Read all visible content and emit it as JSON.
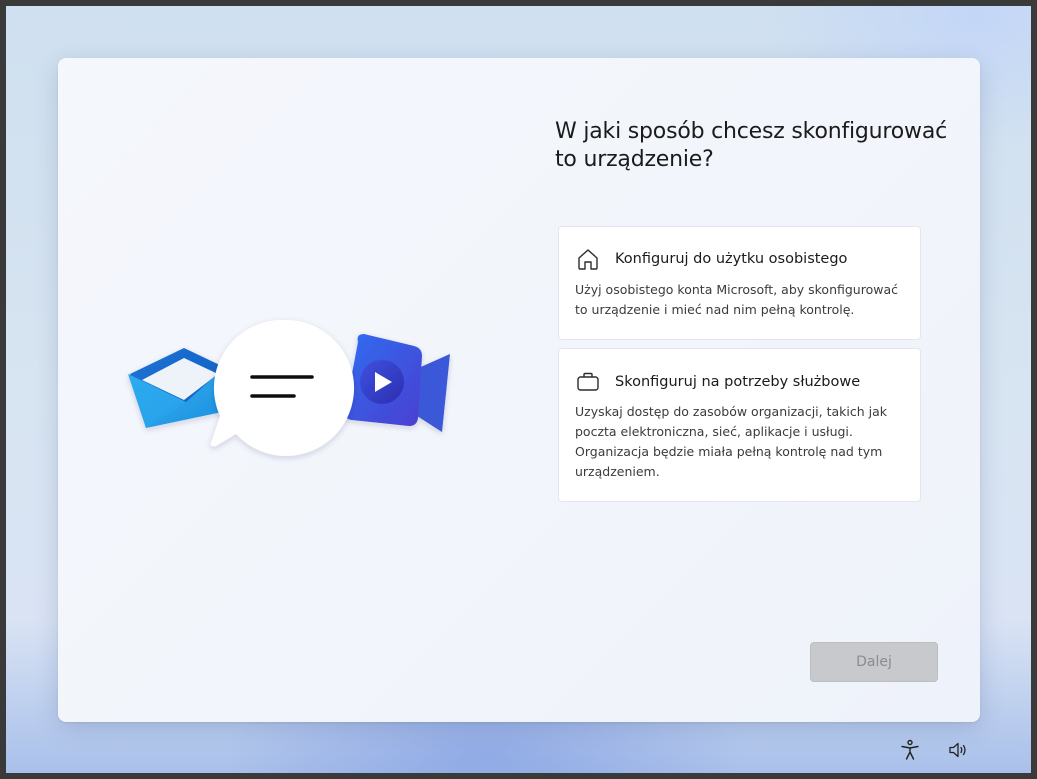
{
  "page": {
    "title": "W jaki sposób chcesz skonfigurować to urządzenie?"
  },
  "options": [
    {
      "title": "Konfiguruj do użytku osobistego",
      "description": "Użyj osobistego konta Microsoft, aby skonfigurować to urządzenie i mieć nad nim pełną kontrolę.",
      "icon": "home-icon"
    },
    {
      "title": "Skonfiguruj na potrzeby służbowe",
      "description": "Uzyskaj dostęp do zasobów organizacji, takich jak poczta elektroniczna, sieć, aplikacje i usługi. Organizacja będzie miała pełną kontrolę nad tym urządzeniem.",
      "icon": "briefcase-icon"
    }
  ],
  "buttons": {
    "next_label": "Dalej"
  },
  "system_tray": {
    "accessibility_icon": "accessibility-icon",
    "volume_icon": "volume-icon"
  },
  "colors": {
    "card_background": "#f3f6fb",
    "button_disabled": "#c8c9cc",
    "button_disabled_text": "#8a8b8e"
  }
}
